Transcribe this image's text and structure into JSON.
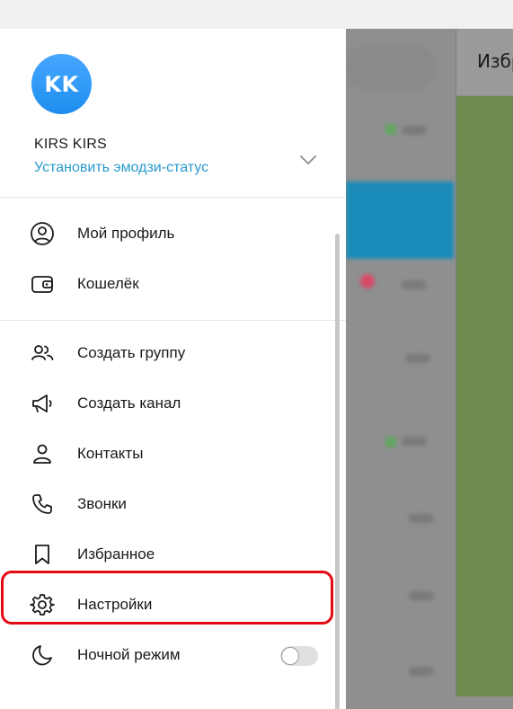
{
  "background": {
    "header_text": "Избранное"
  },
  "account": {
    "initials": "KK",
    "name": "KIRS KIRS",
    "emoji_status_link": "Установить эмодзи-статус",
    "avatar_color": "#2c95f3",
    "link_color": "#2a9acd"
  },
  "menu": {
    "section1": [
      {
        "label": "Мой профиль",
        "icon": "profile-icon"
      },
      {
        "label": "Кошелёк",
        "icon": "wallet-icon"
      }
    ],
    "section2": [
      {
        "label": "Создать группу",
        "icon": "group-icon"
      },
      {
        "label": "Создать канал",
        "icon": "megaphone-icon"
      },
      {
        "label": "Контакты",
        "icon": "contact-icon"
      },
      {
        "label": "Звонки",
        "icon": "phone-icon"
      },
      {
        "label": "Избранное",
        "icon": "bookmark-icon"
      },
      {
        "label": "Настройки",
        "icon": "gear-icon"
      },
      {
        "label": "Ночной режим",
        "icon": "moon-icon",
        "toggle": false
      }
    ]
  },
  "highlight_color": "#e50914"
}
